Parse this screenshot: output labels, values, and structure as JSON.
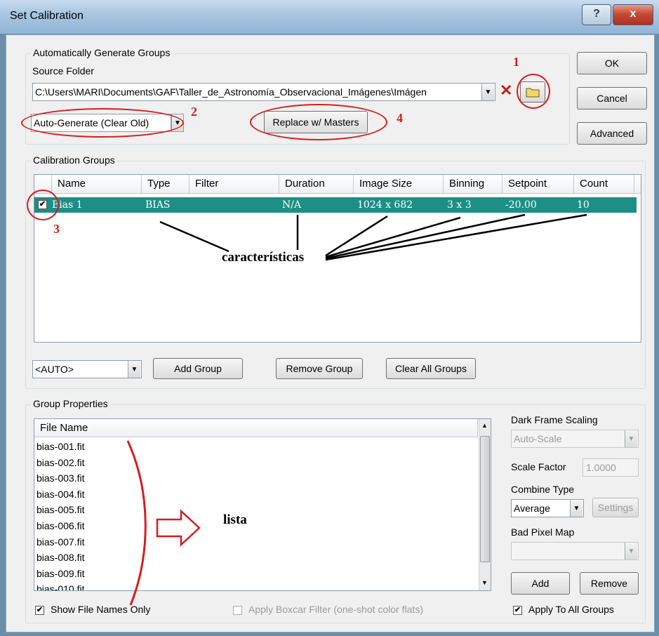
{
  "window": {
    "title": "Set Calibration",
    "help_label": "?",
    "close_label": "x"
  },
  "buttons": {
    "ok": "OK",
    "cancel": "Cancel",
    "advanced": "Advanced"
  },
  "auto_groups": {
    "legend": "Automatically Generate Groups",
    "source_label": "Source Folder",
    "source_value": "C:\\Users\\MARI\\Documents\\GAF\\Taller_de_Astronomía_Observacional_Imágenes\\Imágen",
    "mode_value": "Auto-Generate (Clear Old)",
    "replace_label": "Replace w/ Masters"
  },
  "calibration_groups": {
    "legend": "Calibration Groups",
    "columns": [
      "Name",
      "Type",
      "Filter",
      "Duration",
      "Image Size",
      "Binning",
      "Setpoint",
      "Count"
    ],
    "rows": [
      {
        "checked": true,
        "name": "Bias 1",
        "type": "BIAS",
        "filter": "",
        "duration": "N/A",
        "image_size": "1024 x 682",
        "binning": "3 x 3",
        "setpoint": "-20.00",
        "count": "10"
      }
    ],
    "selection_color": "#1d8f86",
    "auto_value": "<AUTO>",
    "add_group": "Add Group",
    "remove_group": "Remove Group",
    "clear_all": "Clear All Groups"
  },
  "group_properties": {
    "legend": "Group Properties",
    "file_header": "File Name",
    "files": [
      "bias-001.fit",
      "bias-002.fit",
      "bias-003.fit",
      "bias-004.fit",
      "bias-005.fit",
      "bias-006.fit",
      "bias-007.fit",
      "bias-008.fit",
      "bias-009.fit"
    ],
    "partial_file": "bias-010.fit",
    "dark_scaling_label": "Dark Frame Scaling",
    "dark_scaling_value": "Auto-Scale",
    "scale_factor_label": "Scale Factor",
    "scale_factor_value": "1.0000",
    "combine_label": "Combine Type",
    "combine_value": "Average",
    "settings_label": "Settings",
    "bad_pixel_label": "Bad Pixel Map",
    "bad_pixel_value": "",
    "add": "Add",
    "remove": "Remove",
    "show_names_only": "Show File Names Only",
    "show_names_checked": true,
    "boxcar": "Apply Boxcar Filter (one-shot color flats)",
    "boxcar_checked": false,
    "apply_all": "Apply To All Groups",
    "apply_all_checked": true
  },
  "annotations": {
    "n1": "1",
    "n2": "2",
    "n3": "3",
    "n4": "4",
    "caracteristicas": "características",
    "lista": "lista",
    "color": "#d41f1f"
  }
}
